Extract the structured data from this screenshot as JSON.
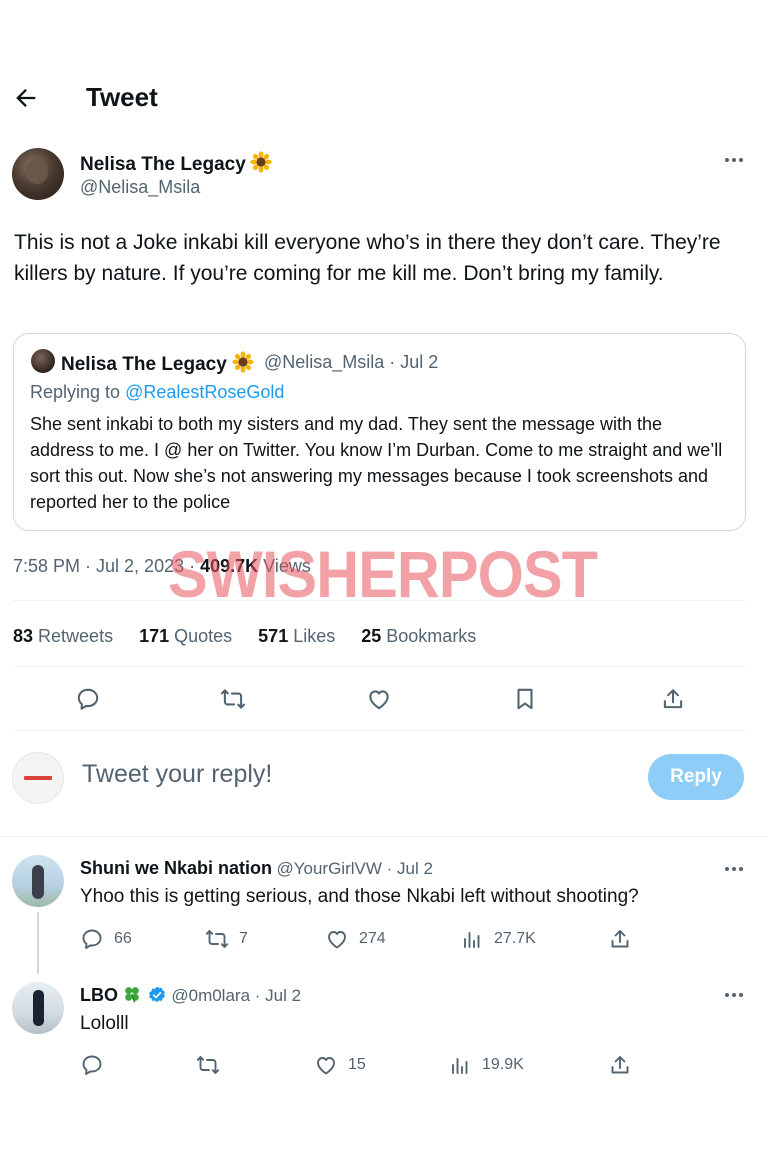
{
  "header": {
    "title": "Tweet"
  },
  "tweet": {
    "author_name": "Nelisa The Legacy",
    "author_emoji": "sunflower",
    "author_handle": "@Nelisa_Msila",
    "text": "This is not a Joke inkabi kill everyone who’s in there they don’t care. They’re killers by nature. If you’re coming for me kill me. Don’t bring my family.",
    "quote": {
      "name": "Nelisa The Legacy",
      "handle_date": "@Nelisa_Msila · Jul 2",
      "replying_prefix": "Replying to ",
      "replying_to": "@RealestRoseGold",
      "text": "She sent inkabi to both my sisters and my dad. They sent the message with the address to me. I @ her on Twitter. You know I’m Durban. Come to me straight and we’ll sort this out. Now she’s not answering my messages because I took screenshots and reported her to the police"
    },
    "time_date": "7:58 PM · Jul 2, 2023 · ",
    "views_count": "409.7K",
    "views_label": " Views",
    "stats": {
      "retweets_count": "83",
      "retweets_label": " Retweets",
      "quotes_count": "171",
      "quotes_label": " Quotes",
      "likes_count": "571",
      "likes_label": " Likes",
      "bookmarks_count": "25",
      "bookmarks_label": " Bookmarks"
    }
  },
  "watermark": "SWISHERPOST",
  "composer": {
    "placeholder": "Tweet your reply!",
    "button_label": "Reply"
  },
  "replies": [
    {
      "name": "Shuni we Nkabi nation",
      "handle_date": "@YourGirlVW · Jul 2",
      "text": "Yhoo this is getting serious, and those Nkabi left without shooting?",
      "replies": "66",
      "retweets": "7",
      "likes": "274",
      "views": "27.7K"
    },
    {
      "name": "LBO",
      "name_emoji": "four-leaf-clover",
      "verified": true,
      "handle_date": "@0m0lara · Jul 2",
      "text": "Lololll",
      "replies": "",
      "retweets": "",
      "likes": "15",
      "views": "19.9K"
    }
  ],
  "colors": {
    "accent": "#1d9bf0",
    "reply_button": "#8ecdf7",
    "secondary_text": "#536471",
    "watermark": "#e8545c"
  }
}
